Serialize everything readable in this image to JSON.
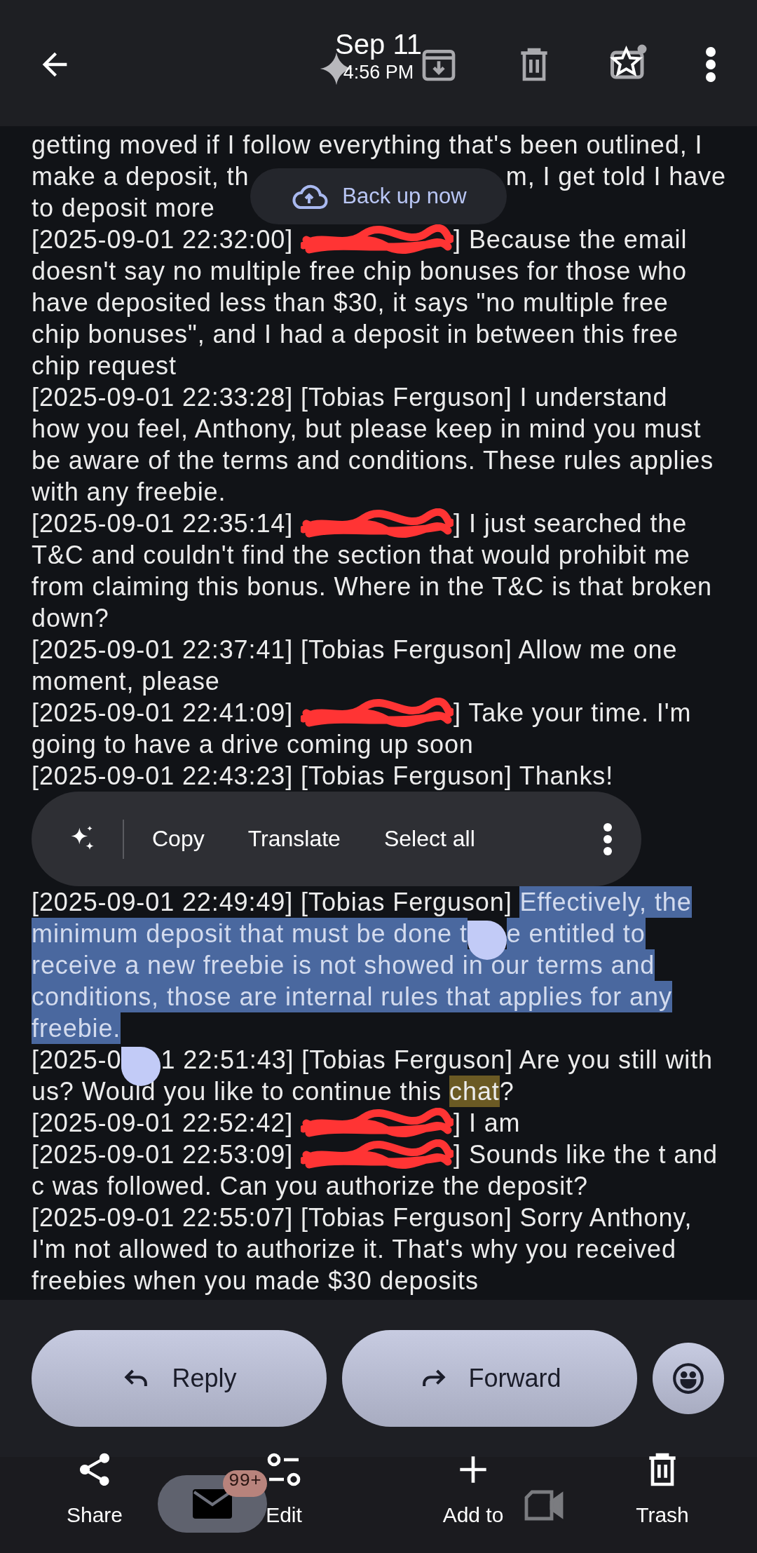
{
  "top_bar": {
    "date": "Sep 11",
    "time": "4:56 PM"
  },
  "backup_chip": {
    "label": "Back up now"
  },
  "message_lines_top": [
    {
      "parts": [
        {
          "kind": "plain",
          "text": "getting moved if I follow everything that's been outlined, I"
        }
      ]
    },
    {
      "kind": "split",
      "parts": [
        {
          "kind": "plain",
          "text": "make a deposit, th"
        },
        {
          "kind": "plain",
          "text": "m, I get told I have"
        }
      ]
    },
    {
      "parts": [
        {
          "kind": "plain",
          "text": "to deposit more"
        }
      ]
    },
    {
      "parts": [
        {
          "kind": "plain",
          "text": "[2025-09-01 22:32:00] "
        },
        {
          "kind": "redacted"
        },
        {
          "kind": "plain",
          "text": "] Because the email"
        }
      ]
    },
    {
      "parts": [
        {
          "kind": "plain",
          "text": "doesn't say no multiple free chip bonuses for those who"
        }
      ]
    },
    {
      "parts": [
        {
          "kind": "plain",
          "text": "have deposited less than $30, it says \"no multiple free"
        }
      ]
    },
    {
      "parts": [
        {
          "kind": "plain",
          "text": "chip bonuses\", and I had a deposit in between this free"
        }
      ]
    },
    {
      "parts": [
        {
          "kind": "plain",
          "text": "chip request"
        }
      ]
    },
    {
      "parts": [
        {
          "kind": "plain",
          "text": "[2025-09-01 22:33:28] [Tobias Ferguson] I understand"
        }
      ]
    },
    {
      "parts": [
        {
          "kind": "plain",
          "text": "how you feel, Anthony, but please keep in mind you must"
        }
      ]
    },
    {
      "parts": [
        {
          "kind": "plain",
          "text": "be aware of the terms and conditions. These rules applies"
        }
      ]
    },
    {
      "parts": [
        {
          "kind": "plain",
          "text": "with any freebie."
        }
      ]
    },
    {
      "parts": [
        {
          "kind": "plain",
          "text": "[2025-09-01 22:35:14] "
        },
        {
          "kind": "redacted"
        },
        {
          "kind": "plain",
          "text": "] I just searched the"
        }
      ]
    },
    {
      "parts": [
        {
          "kind": "plain",
          "text": "T&C and couldn't find the section that would prohibit me"
        }
      ]
    },
    {
      "parts": [
        {
          "kind": "plain",
          "text": "from claiming this bonus. Where in the T&C is that broken"
        }
      ]
    },
    {
      "parts": [
        {
          "kind": "plain",
          "text": "down?"
        }
      ]
    },
    {
      "parts": [
        {
          "kind": "plain",
          "text": "[2025-09-01 22:37:41] [Tobias Ferguson] Allow me one"
        }
      ]
    },
    {
      "parts": [
        {
          "kind": "plain",
          "text": "moment, please"
        }
      ]
    },
    {
      "parts": [
        {
          "kind": "plain",
          "text": "[2025-09-01 22:41:09] "
        },
        {
          "kind": "redacted"
        },
        {
          "kind": "plain",
          "text": "] Take your time. I'm"
        }
      ]
    },
    {
      "parts": [
        {
          "kind": "plain",
          "text": "going to have a drive coming up soon"
        }
      ]
    },
    {
      "parts": [
        {
          "kind": "plain",
          "text": "[2025-09-01 22:43:23] [Tobias Ferguson] Thanks!"
        }
      ]
    }
  ],
  "text_menu": {
    "items": [
      "Copy",
      "Translate",
      "Select all"
    ]
  },
  "message_lines_bottom": [
    {
      "parts": [
        {
          "kind": "plain",
          "text": "[2025-09-01 22:49:49] [Tobias Ferguson] "
        },
        {
          "kind": "selected",
          "text": "Effectively, the"
        }
      ]
    },
    {
      "parts": [
        {
          "kind": "selected",
          "text": "minimum deposit that must be done t"
        },
        {
          "kind": "handle"
        },
        {
          "kind": "selected",
          "text": "e entitled to"
        }
      ]
    },
    {
      "parts": [
        {
          "kind": "selected",
          "text": "receive a new freebie is not showed in our terms and"
        }
      ]
    },
    {
      "parts": [
        {
          "kind": "selected",
          "text": "conditions, those are internal rules that applies for any"
        }
      ]
    },
    {
      "parts": [
        {
          "kind": "selected",
          "text": "freebie."
        }
      ]
    },
    {
      "parts": [
        {
          "kind": "plain",
          "text": "[2025-0"
        },
        {
          "kind": "handle"
        },
        {
          "kind": "plain",
          "text": "1 22:51:43] [Tobias Ferguson] Are you still with"
        }
      ]
    },
    {
      "parts": [
        {
          "kind": "plain",
          "text": "us? Would you like to continue this "
        },
        {
          "kind": "match",
          "text": "chat"
        },
        {
          "kind": "plain",
          "text": "?"
        }
      ]
    },
    {
      "parts": [
        {
          "kind": "plain",
          "text": "[2025-09-01 22:52:42] "
        },
        {
          "kind": "redacted"
        },
        {
          "kind": "plain",
          "text": "] I am"
        }
      ]
    },
    {
      "parts": [
        {
          "kind": "plain",
          "text": "[2025-09-01 22:53:09] "
        },
        {
          "kind": "redacted"
        },
        {
          "kind": "plain",
          "text": "] Sounds like the t and"
        }
      ]
    },
    {
      "parts": [
        {
          "kind": "plain",
          "text": "c was followed. Can you authorize the deposit?"
        }
      ]
    },
    {
      "parts": [
        {
          "kind": "plain",
          "text": "[2025-09-01 22:55:07] [Tobias Ferguson] Sorry Anthony,"
        }
      ]
    },
    {
      "parts": [
        {
          "kind": "plain",
          "text": "I'm not allowed to authorize it. That's why you received"
        }
      ]
    },
    {
      "parts": [
        {
          "kind": "plain",
          "text": "freebies when you made $30 deposits"
        }
      ]
    }
  ],
  "actions": [
    {
      "kind": "reply",
      "label": "Reply"
    },
    {
      "kind": "forward",
      "label": "Forward"
    }
  ],
  "bottom_nav": [
    {
      "kind": "share",
      "label": "Share"
    },
    {
      "kind": "edit",
      "label": "Edit"
    },
    {
      "kind": "add",
      "label": "Add to"
    },
    {
      "kind": "trash",
      "label": "Trash"
    }
  ],
  "chat_bubble": {
    "badge": "99+"
  }
}
